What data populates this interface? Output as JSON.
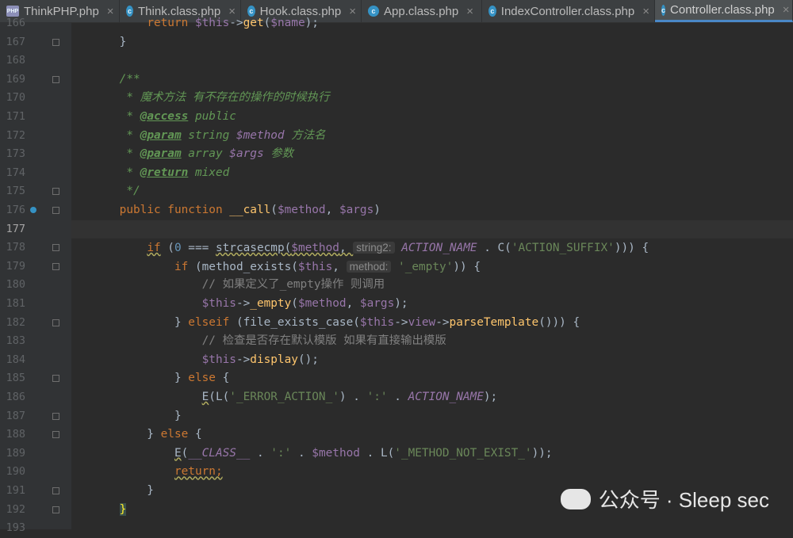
{
  "tabs": [
    {
      "label": "ThinkPHP.php",
      "icon": "php-file-icon",
      "active": false
    },
    {
      "label": "Think.class.php",
      "icon": "class-icon",
      "active": false
    },
    {
      "label": "Hook.class.php",
      "icon": "class-icon",
      "active": false
    },
    {
      "label": "App.class.php",
      "icon": "class-icon",
      "active": false
    },
    {
      "label": "IndexController.class.php",
      "icon": "class-icon",
      "active": false
    },
    {
      "label": "Controller.class.php",
      "icon": "class-icon",
      "active": true
    }
  ],
  "tab_close_glyph": "×",
  "current_line": 177,
  "lines": [
    {
      "n": 166,
      "html": "        <span class=\"kw\">return</span> <span class=\"var\">$this</span>-><span class=\"fn\">get</span>(<span class=\"var\">$name</span>);"
    },
    {
      "n": 167,
      "html": "    }"
    },
    {
      "n": 168,
      "html": ""
    },
    {
      "n": 169,
      "html": "    <span class=\"doc\">/**</span>"
    },
    {
      "n": 170,
      "html": "     <span class=\"doc\">* 魔术方法 有不存在的操作的时候执行</span>"
    },
    {
      "n": 171,
      "html": "     <span class=\"doc\">* </span><span class=\"tag\">@access</span><span class=\"doc\"> public</span>"
    },
    {
      "n": 172,
      "html": "     <span class=\"doc\">* </span><span class=\"tag\">@param</span><span class=\"doc\"> string </span><span class=\"const\">$method</span><span class=\"doc\"> 方法名</span>"
    },
    {
      "n": 173,
      "html": "     <span class=\"doc\">* </span><span class=\"tag\">@param</span><span class=\"doc\"> array </span><span class=\"const\">$args</span><span class=\"doc\"> 参数</span>"
    },
    {
      "n": 174,
      "html": "     <span class=\"doc\">* </span><span class=\"tag\">@return</span><span class=\"doc\"> mixed</span>"
    },
    {
      "n": 175,
      "html": "     <span class=\"doc\">*/</span>"
    },
    {
      "n": 176,
      "html": "    <span class=\"kw\">public function</span> <span class=\"fn\">__call</span>(<span class=\"var\">$method</span>, <span class=\"var\">$args</span>)"
    },
    {
      "n": 177,
      "html": "    <span class=\"brace\">{</span>"
    },
    {
      "n": 178,
      "html": "        <span class=\"kw wavy\">if</span> (<span class=\"num\">0</span> === <span class=\"wavy\">strcasecmp(<span class=\"var\">$method</span>, </span><span class=\"hint\">string2:</span> <span class=\"const\">ACTION_NAME</span> . C(<span class=\"str\">'ACTION_SUFFIX'</span>))) {"
    },
    {
      "n": 179,
      "html": "            <span class=\"kw\">if</span> (method_exists(<span class=\"var\">$this</span>, <span class=\"hint\">method:</span> <span class=\"str\">'_empty'</span>)) {"
    },
    {
      "n": 180,
      "html": "                <span class=\"cmt\">// 如果定义了_empty操作 则调用</span>"
    },
    {
      "n": 181,
      "html": "                <span class=\"var\">$this</span>-><span class=\"fn\">_empty</span>(<span class=\"var\">$method</span>, <span class=\"var\">$args</span>);"
    },
    {
      "n": 182,
      "html": "            } <span class=\"kw\">elseif</span> (file_exists_case(<span class=\"var\">$this</span>-><span class=\"var\">view</span>-><span class=\"fn\">parseTemplate</span>())) {"
    },
    {
      "n": 183,
      "html": "                <span class=\"cmt\">// 检查是否存在默认模版 如果有直接输出模版</span>"
    },
    {
      "n": 184,
      "html": "                <span class=\"var\">$this</span>-><span class=\"fn\">display</span>();"
    },
    {
      "n": 185,
      "html": "            } <span class=\"kw\">else</span> {"
    },
    {
      "n": 186,
      "html": "                <span class=\"wavy\">E</span>(L(<span class=\"str\">'_ERROR_ACTION_'</span>) . <span class=\"str\">':'</span> . <span class=\"const\">ACTION_NAME</span>);"
    },
    {
      "n": 187,
      "html": "            }"
    },
    {
      "n": 188,
      "html": "        } <span class=\"kw\">else</span> {"
    },
    {
      "n": 189,
      "html": "            <span class=\"wavy\">E</span>(<span class=\"const\">__CLASS__</span> . <span class=\"str\">':'</span> . <span class=\"var\">$method</span> . L(<span class=\"str\">'_METHOD_NOT_EXIST_'</span>));"
    },
    {
      "n": 190,
      "html": "            <span class=\"kw wavy\">return;</span>"
    },
    {
      "n": 191,
      "html": "        }"
    },
    {
      "n": 192,
      "html": "    <span class=\"brace\">}</span>"
    },
    {
      "n": 193,
      "html": ""
    }
  ],
  "watermark": "公众号 · Sleep sec"
}
